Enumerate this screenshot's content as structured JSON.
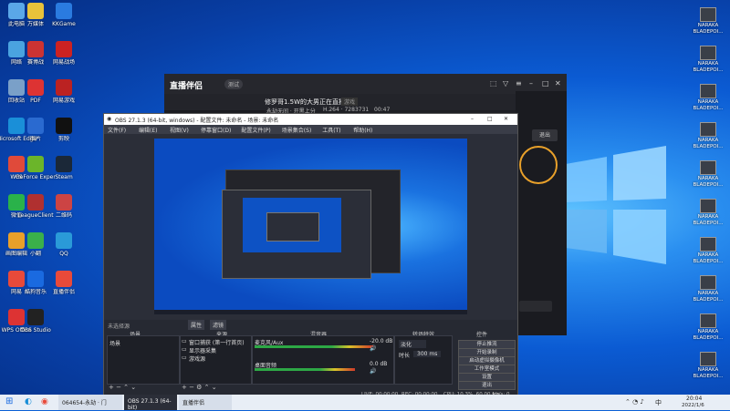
{
  "desktop_left": [
    {
      "name": "此电脑",
      "color": "#5aa7e8"
    },
    {
      "name": "万媒体",
      "color": "#e8c23a"
    },
    {
      "name": "KKGame",
      "color": "#2a7be0"
    },
    {
      "name": "网络",
      "color": "#4aa3e0"
    },
    {
      "name": "赛博战",
      "color": "#c33"
    },
    {
      "name": "网易战场",
      "color": "#c22"
    },
    {
      "name": "回收站",
      "color": "#7aa0c8"
    },
    {
      "name": "PDF",
      "color": "#d33"
    },
    {
      "name": "网易游戏",
      "color": "#b22"
    },
    {
      "name": "Microsoft Edge",
      "color": "#1a8fd8"
    },
    {
      "name": "图片",
      "color": "#2a6ad0"
    },
    {
      "name": "剪映",
      "color": "#111"
    },
    {
      "name": "WPS",
      "color": "#e04a3a"
    },
    {
      "name": "GeForce Experience",
      "color": "#6bb52a"
    },
    {
      "name": "Steam",
      "color": "#1b2838"
    },
    {
      "name": "微信",
      "color": "#2ab24a"
    },
    {
      "name": "LeagueClient",
      "color": "#b03030"
    },
    {
      "name": "二维码",
      "color": "#c44"
    },
    {
      "name": "画图编辑",
      "color": "#e8a02a"
    },
    {
      "name": "小翻",
      "color": "#3ab04a"
    },
    {
      "name": "QQ",
      "color": "#2a9ad8"
    },
    {
      "name": "网易",
      "color": "#e84a3a"
    },
    {
      "name": "酷狗音乐",
      "color": "#1a6ae0"
    },
    {
      "name": "直播伴侣",
      "color": "#e84a3a"
    },
    {
      "name": "WPS Office",
      "color": "#d33"
    },
    {
      "name": "OBS Studio",
      "color": "#222"
    }
  ],
  "desktop_right_label": "NARAKA BLADEPOI...",
  "companion": {
    "logo": "直播伴侣",
    "version": "测试",
    "stream_title": "修罗哥1.5W的大男正在直播",
    "tag": "游戏",
    "sub1": "永劫无间 · 开黑上分",
    "sub2": "H.264 · 7283731",
    "sub3": "00:47",
    "exit_label": "退出"
  },
  "obs": {
    "title": "OBS 27.1.3 (64-bit, windows) - 配置文件: 未命名 - 场景: 未命名",
    "menu": [
      "文件(F)",
      "编辑(E)",
      "视图(V)",
      "停靠窗口(D)",
      "配置文件(P)",
      "场景集合(S)",
      "工具(T)",
      "帮助(H)"
    ],
    "source_label": "未选择源",
    "props_label": "属性",
    "filter_label": "滤镜",
    "panels": {
      "scenes": "场景",
      "sources": "来源",
      "mixer": "混音器",
      "transitions": "转场特效",
      "controls": "控件"
    },
    "scene_item": "场景",
    "sources_list": [
      "窗口捕获 (第一行首页)",
      "显示器采集",
      "游戏源"
    ],
    "mixer": {
      "track1_name": "麦克风/Aux",
      "track1_db": "-20.0 dB",
      "track2_name": "桌面音频",
      "track2_db": "0.0 dB"
    },
    "transition": {
      "type": "淡化",
      "duration_label": "时长",
      "duration": "300 ms"
    },
    "controls": [
      "停止推流",
      "开始录制",
      "启动虚拟摄像机",
      "工作室模式",
      "设置",
      "退出"
    ],
    "status": {
      "live": "LIVE: 00:00:00",
      "rec": "REC: 00:00:00",
      "cpu": "CPU: 10.3%, 60.00 fps",
      "kbps": "kb/s: 0"
    }
  },
  "taskbar": {
    "items": [
      "064654-永劫 · 门",
      "OBS 27.1.3 (64-bit)",
      "直播伴侣"
    ],
    "time": "20:04",
    "date": "2022/1/6",
    "lang": "中"
  }
}
